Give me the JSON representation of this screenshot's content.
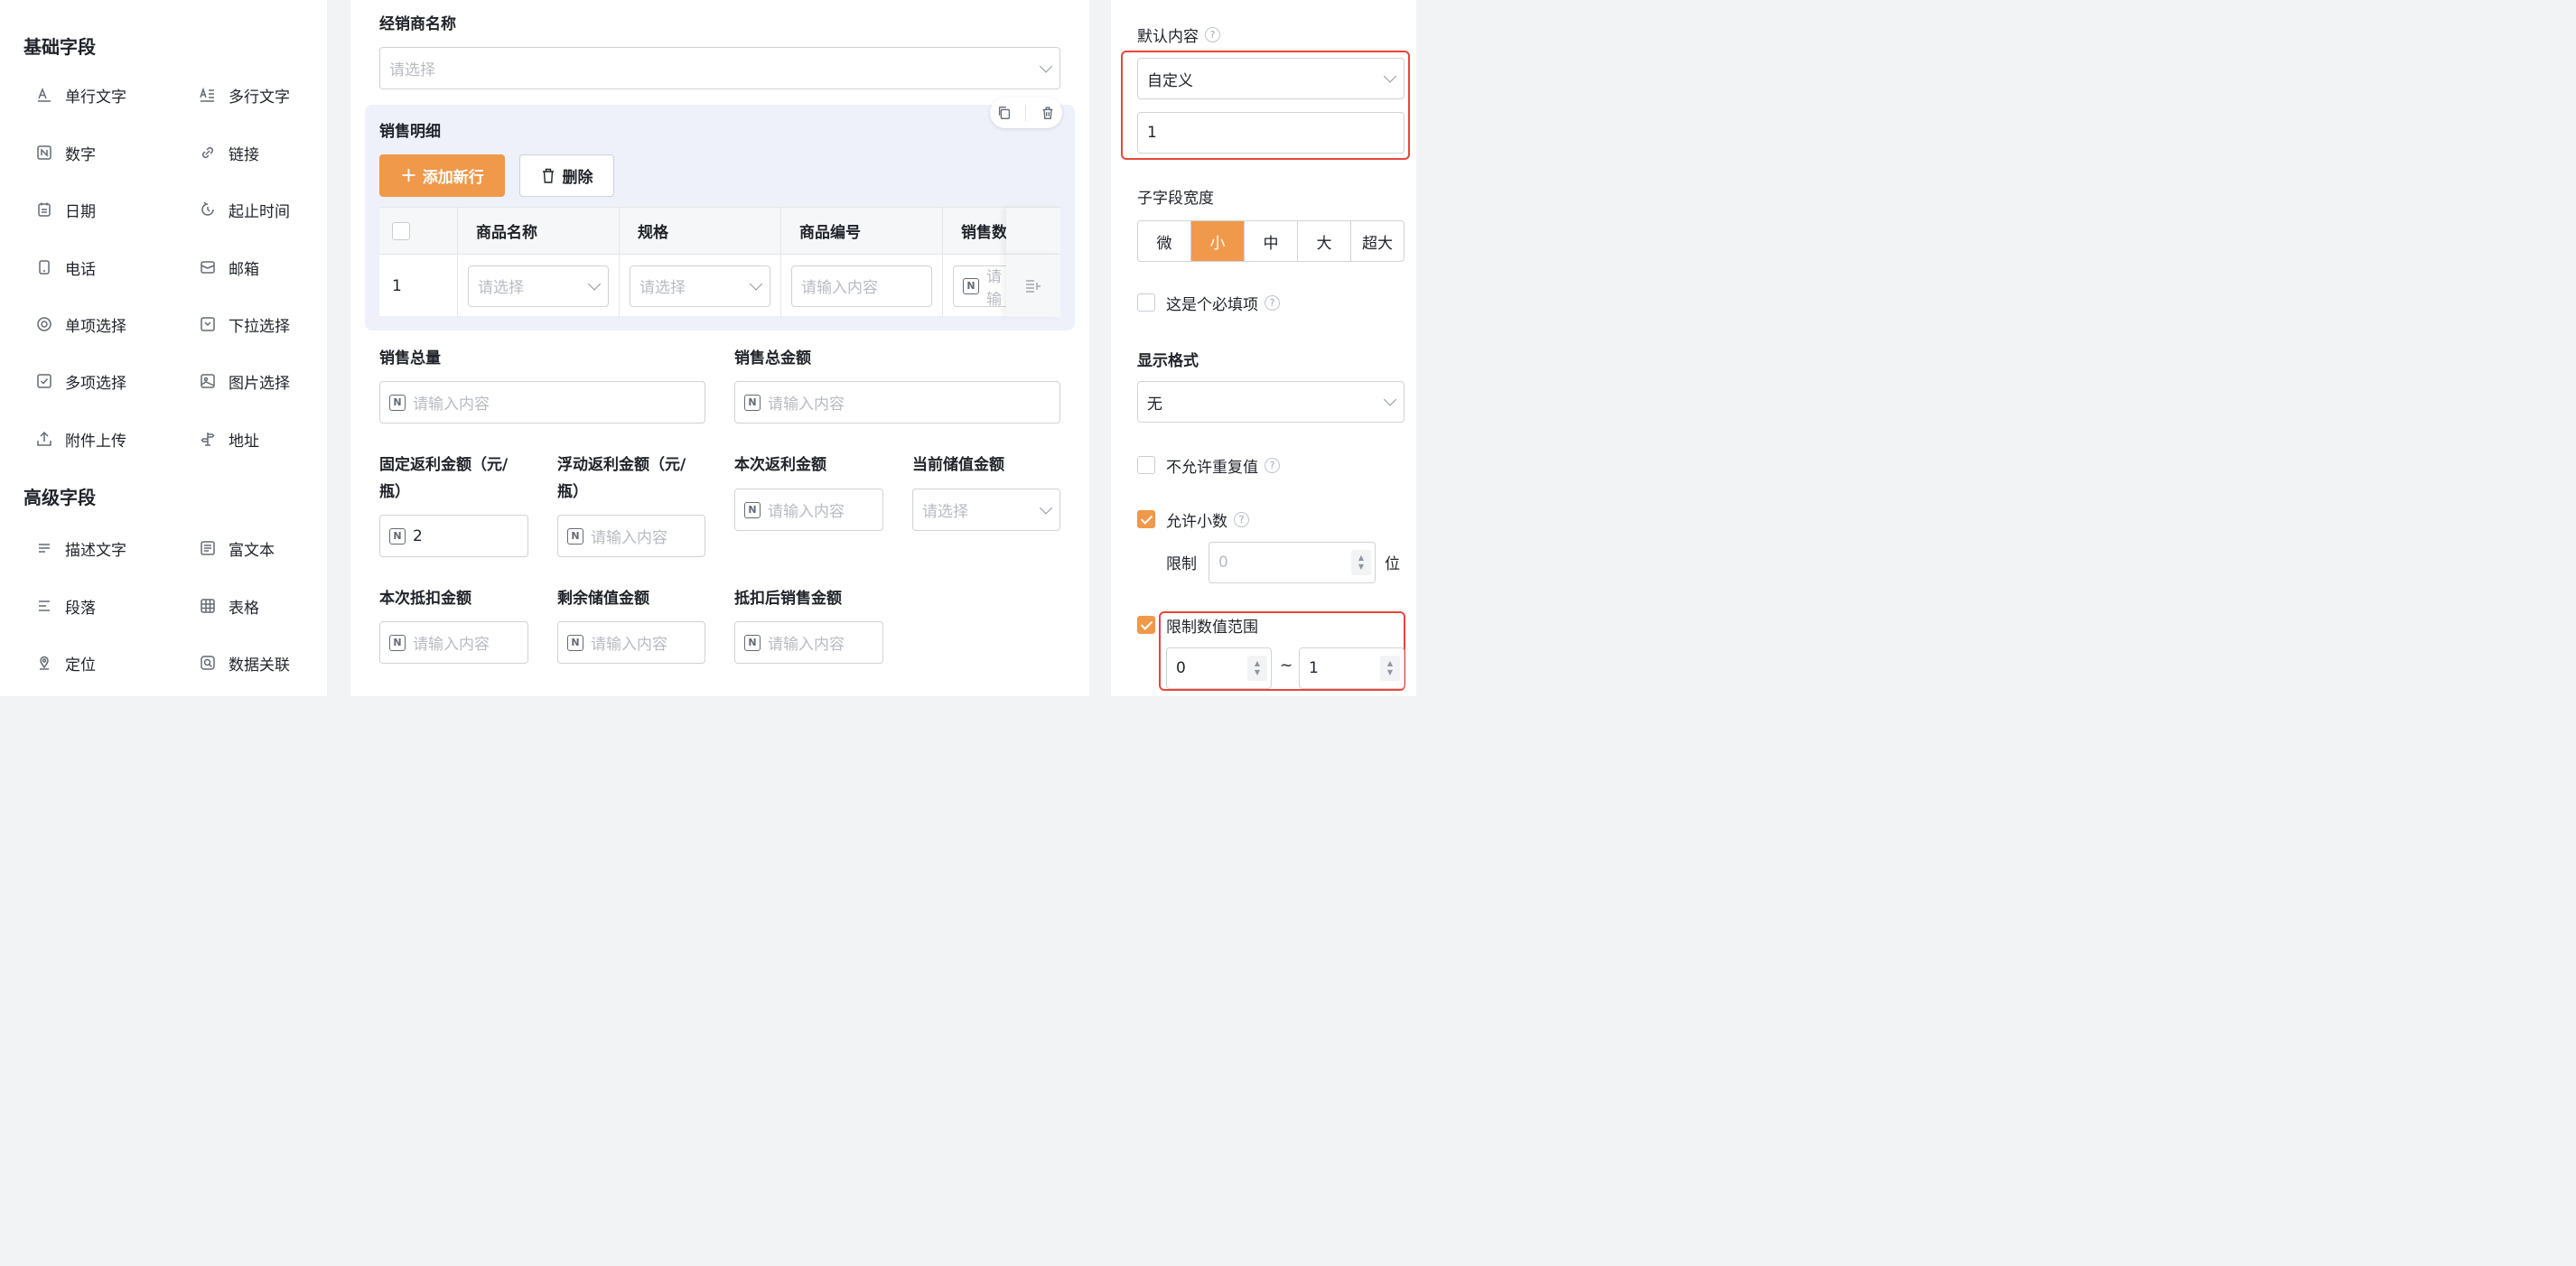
{
  "left_panel": {
    "basic_title": "基础字段",
    "advanced_title": "高级字段",
    "basic_items": [
      {
        "label": "单行文字",
        "icon": "text-a-icon"
      },
      {
        "label": "多行文字",
        "icon": "multiline-text-icon"
      },
      {
        "label": "数字",
        "icon": "number-icon"
      },
      {
        "label": "链接",
        "icon": "link-icon"
      },
      {
        "label": "日期",
        "icon": "calendar-icon"
      },
      {
        "label": "起止时间",
        "icon": "time-range-icon"
      },
      {
        "label": "电话",
        "icon": "phone-icon"
      },
      {
        "label": "邮箱",
        "icon": "mail-icon"
      },
      {
        "label": "单项选择",
        "icon": "radio-icon"
      },
      {
        "label": "下拉选择",
        "icon": "dropdown-icon"
      },
      {
        "label": "多项选择",
        "icon": "checkbox-icon"
      },
      {
        "label": "图片选择",
        "icon": "image-icon"
      },
      {
        "label": "附件上传",
        "icon": "upload-icon"
      },
      {
        "label": "地址",
        "icon": "address-icon"
      }
    ],
    "advanced_items": [
      {
        "label": "描述文字",
        "icon": "description-icon"
      },
      {
        "label": "富文本",
        "icon": "richtext-icon"
      },
      {
        "label": "段落",
        "icon": "paragraph-icon"
      },
      {
        "label": "表格",
        "icon": "table-icon"
      },
      {
        "label": "定位",
        "icon": "location-icon"
      },
      {
        "label": "数据关联",
        "icon": "data-link-icon"
      }
    ]
  },
  "form": {
    "dealer_label": "经销商名称",
    "dealer_placeholder": "请选择",
    "subtable_title": "销售明细",
    "add_row_label": "添加新行",
    "delete_label": "删除",
    "columns": [
      "商品名称",
      "规格",
      "商品编号",
      "销售数"
    ],
    "row_index": "1",
    "cell_select_ph": "请选择",
    "cell_input_ph": "请输入内容",
    "cell_number_ph": "请输",
    "sales_total_label": "销售总量",
    "sales_amount_label": "销售总金额",
    "input_ph": "请输入内容",
    "fixed_rebate_label_1": "固定返利金额（元/",
    "fixed_rebate_label_2": "瓶）",
    "fixed_rebate_value": "2",
    "float_rebate_label_1": "浮动返利金额（元/",
    "float_rebate_label_2": "瓶）",
    "current_rebate_label": "本次返利金额",
    "stored_value_label": "当前储值金额",
    "select_ph": "请选择",
    "deduct_label": "本次抵扣金额",
    "remain_label": "剩余储值金额",
    "after_deduct_label": "抵扣后销售金额"
  },
  "props": {
    "default_label": "默认内容",
    "default_mode": "自定义",
    "default_value": "1",
    "width_label": "子字段宽度",
    "width_options": [
      "微",
      "小",
      "中",
      "大",
      "超大"
    ],
    "width_selected": "小",
    "required_label": "这是个必填项",
    "format_label": "显示格式",
    "format_value": "无",
    "no_dup_label": "不允许重复值",
    "decimal_label": "允许小数",
    "limit_label": "限制",
    "limit_ph": "0",
    "limit_unit": "位",
    "range_label": "限制数值范围",
    "range_min": "0",
    "range_sep": "~",
    "range_max": "1",
    "accent": "#f0994a",
    "highlight": "#e8463a"
  }
}
